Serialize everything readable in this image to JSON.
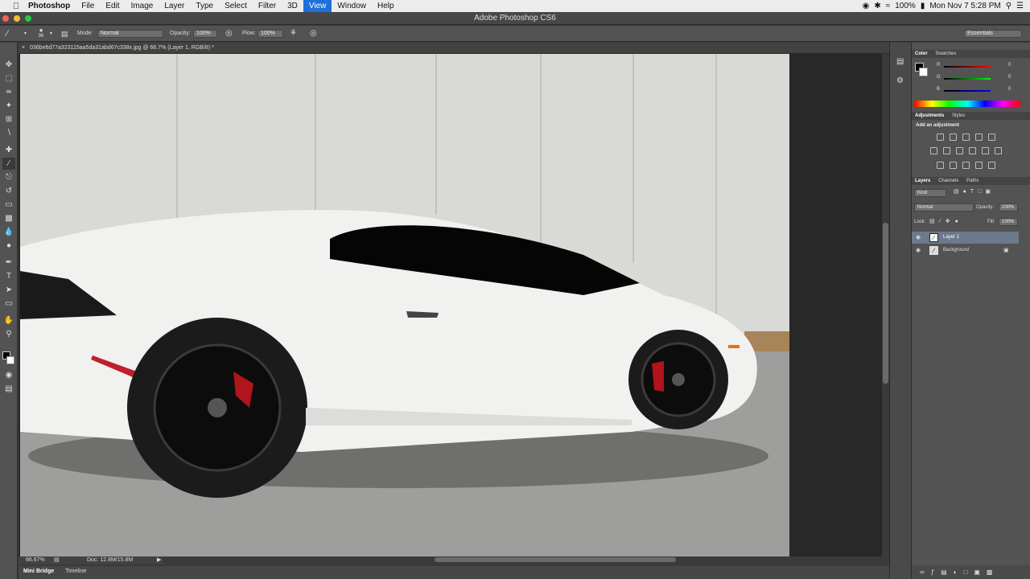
{
  "menubar": {
    "apple": "",
    "items": [
      "Photoshop",
      "File",
      "Edit",
      "Image",
      "Layer",
      "Type",
      "Select",
      "Filter",
      "3D",
      "View",
      "Window",
      "Help"
    ],
    "active_item": "View",
    "battery": "100%",
    "datetime": "Mon Nov 7  5:28 PM"
  },
  "window": {
    "title": "Adobe Photoshop CS6"
  },
  "options": {
    "brush_size": "96",
    "mode_label": "Mode:",
    "mode_value": "Normal",
    "opacity_label": "Opacity:",
    "opacity_value": "100%",
    "flow_label": "Flow:",
    "flow_value": "100%",
    "workspace": "Essentials"
  },
  "document": {
    "tab_title": "036be6d77a323115aa5da31abd67c338x.jpg @ 66.7% (Layer 1, RGB/8) *",
    "zoom": "66.67%",
    "doc_size": "Doc: 12.8M/15.8M"
  },
  "bottom_tabs": [
    "Mini Bridge",
    "Timeline"
  ],
  "color_panel": {
    "tabs": [
      "Color",
      "Swatches"
    ],
    "r_label": "R",
    "r_value": "0",
    "g_label": "G",
    "g_value": "0",
    "b_label": "B",
    "b_value": "0"
  },
  "adjustments_panel": {
    "tabs": [
      "Adjustments",
      "Styles"
    ],
    "heading": "Add an adjustment"
  },
  "layers_panel": {
    "tabs": [
      "Layers",
      "Channels",
      "Paths"
    ],
    "kind_label": "Kind",
    "blend_mode": "Normal",
    "opacity_label": "Opacity:",
    "opacity_value": "100%",
    "lock_label": "Lock:",
    "fill_label": "Fill:",
    "fill_value": "100%",
    "layers": [
      {
        "name": "Layer 1",
        "selected": true
      },
      {
        "name": "Background",
        "selected": false
      }
    ]
  },
  "colors": {
    "menu_active": "#1e6fd9",
    "panel_bg": "#535353",
    "selected_layer": "#6b7a8c"
  }
}
